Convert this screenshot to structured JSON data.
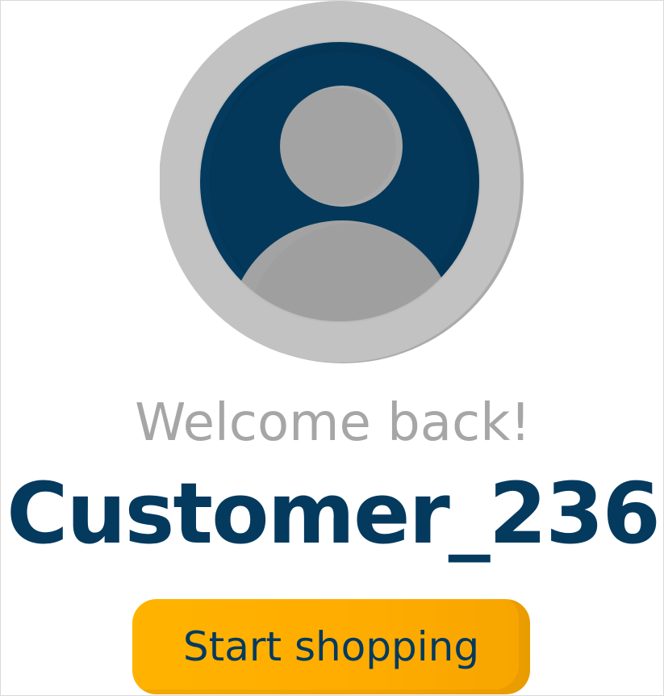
{
  "profile": {
    "avatar_icon": "user-avatar-icon",
    "greeting": "Welcome back!",
    "username": "Customer_236"
  },
  "actions": {
    "start_label": "Start shopping"
  },
  "colors": {
    "brand_navy": "#053a5f",
    "accent_yellow": "#ffb000",
    "muted_gray": "#a6a6a6",
    "ring_gray": "#bdbdbd"
  }
}
